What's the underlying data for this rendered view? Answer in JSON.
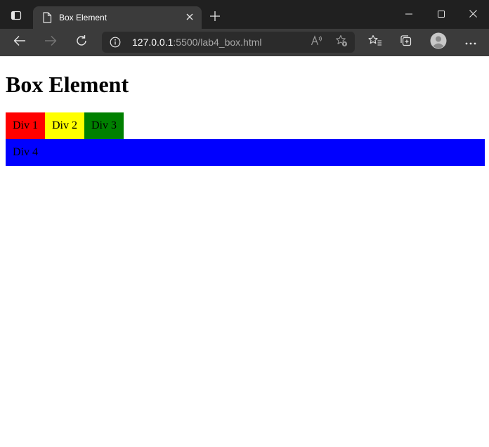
{
  "browser": {
    "tab": {
      "title": "Box Element"
    },
    "url": {
      "host": "127.0.0.1",
      "path": ":5500/lab4_box.html"
    }
  },
  "page": {
    "heading": "Box Element",
    "boxes": [
      {
        "label": "Div 1",
        "color": "#ff0000"
      },
      {
        "label": "Div 2",
        "color": "#ffff00"
      },
      {
        "label": "Div 3",
        "color": "#008000"
      },
      {
        "label": "Div 4",
        "color": "#0000ff"
      }
    ]
  }
}
